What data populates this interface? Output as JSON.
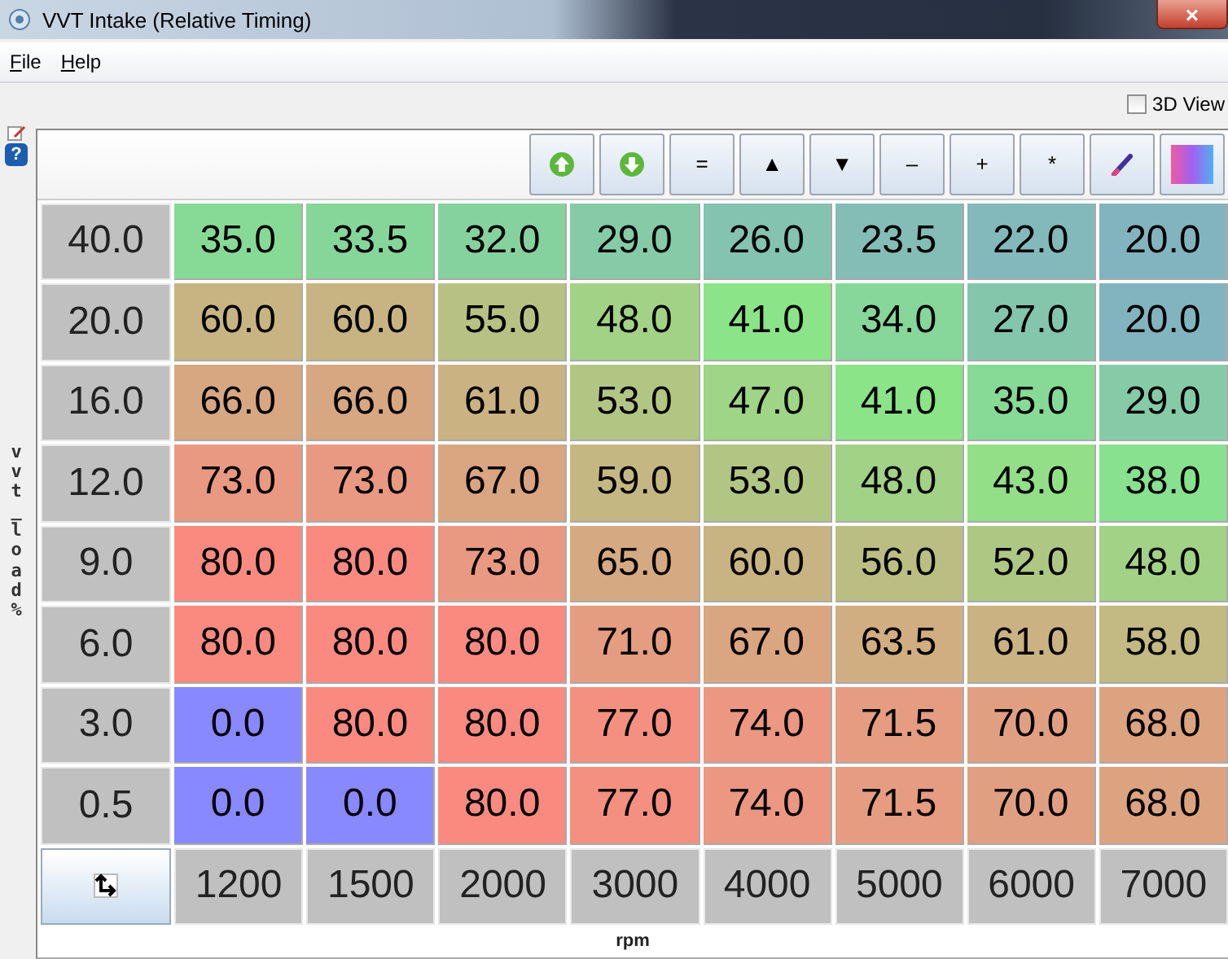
{
  "window": {
    "title": "VVT Intake (Relative Timing)",
    "close": "×"
  },
  "menu": [
    {
      "label": "File"
    },
    {
      "label": "Help"
    }
  ],
  "view_3d": {
    "label": "3D View",
    "checked": false
  },
  "side": {
    "help": "?"
  },
  "toolbar": [
    {
      "kind": "up"
    },
    {
      "kind": "down"
    },
    {
      "kind": "text",
      "label": "="
    },
    {
      "kind": "text",
      "label": "▲"
    },
    {
      "kind": "text",
      "label": "▼"
    },
    {
      "kind": "text",
      "label": "–"
    },
    {
      "kind": "text",
      "label": "+"
    },
    {
      "kind": "text",
      "label": "*"
    },
    {
      "kind": "pen"
    },
    {
      "kind": "gradient"
    }
  ],
  "table": {
    "y_label": "vvt_load %",
    "x_label": "rpm",
    "rows": [
      {
        "load": "40.0",
        "values": [
          "35.0",
          "33.5",
          "32.0",
          "29.0",
          "26.0",
          "23.5",
          "22.0",
          "20.0"
        ]
      },
      {
        "load": "20.0",
        "values": [
          "60.0",
          "60.0",
          "55.0",
          "48.0",
          "41.0",
          "34.0",
          "27.0",
          "20.0"
        ]
      },
      {
        "load": "16.0",
        "values": [
          "66.0",
          "66.0",
          "61.0",
          "53.0",
          "47.0",
          "41.0",
          "35.0",
          "29.0"
        ]
      },
      {
        "load": "12.0",
        "values": [
          "73.0",
          "73.0",
          "67.0",
          "59.0",
          "53.0",
          "48.0",
          "43.0",
          "38.0"
        ]
      },
      {
        "load": "9.0",
        "values": [
          "80.0",
          "80.0",
          "73.0",
          "65.0",
          "60.0",
          "56.0",
          "52.0",
          "48.0"
        ]
      },
      {
        "load": "6.0",
        "values": [
          "80.0",
          "80.0",
          "80.0",
          "71.0",
          "67.0",
          "63.5",
          "61.0",
          "58.0"
        ]
      },
      {
        "load": "3.0",
        "values": [
          "0.0",
          "80.0",
          "80.0",
          "77.0",
          "74.0",
          "71.5",
          "70.0",
          "68.0"
        ]
      },
      {
        "load": "0.5",
        "values": [
          "0.0",
          "0.0",
          "80.0",
          "77.0",
          "74.0",
          "71.5",
          "70.0",
          "68.0"
        ]
      }
    ],
    "rpm": [
      "1200",
      "1500",
      "2000",
      "3000",
      "4000",
      "5000",
      "6000",
      "7000"
    ]
  }
}
